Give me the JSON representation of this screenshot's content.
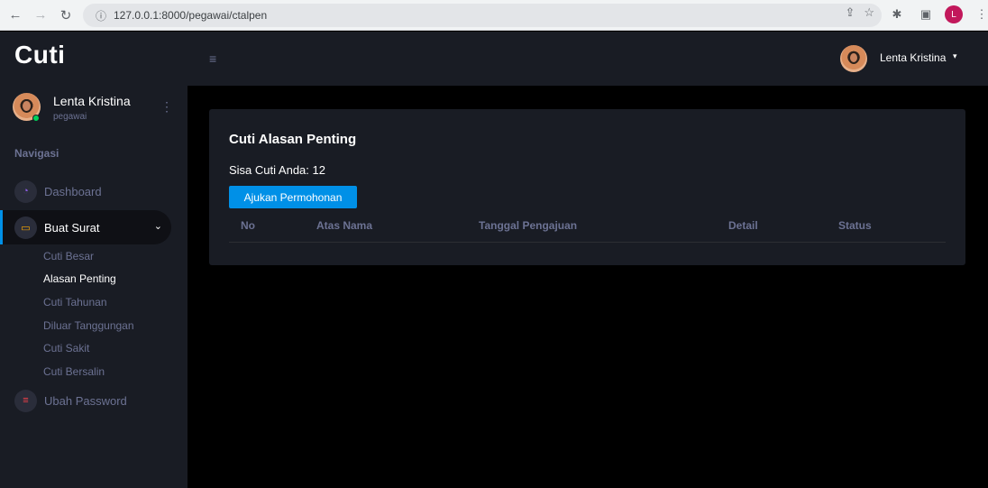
{
  "browser": {
    "url": "127.0.0.1:8000/pegawai/ctalpen",
    "profile_initial": "L"
  },
  "app": {
    "brand": "Cuti"
  },
  "sidebar": {
    "profile": {
      "name": "Lenta Kristina",
      "role": "pegawai",
      "status": "online"
    },
    "nav_title": "Navigasi",
    "items": [
      {
        "label": "Dashboard",
        "icon": "speedometer-icon",
        "icon_color": "#8f5fe8"
      },
      {
        "label": "Buat Surat",
        "icon": "laptop-icon",
        "icon_color": "#ffab00",
        "active": true
      },
      {
        "label": "Ubah Password",
        "icon": "key-icon",
        "icon_color": "#fc424a"
      }
    ],
    "sub_items": [
      {
        "label": "Cuti Besar"
      },
      {
        "label": "Alasan Penting",
        "current": true
      },
      {
        "label": "Cuti Tahunan"
      },
      {
        "label": "Diluar Tanggungan"
      },
      {
        "label": "Cuti Sakit"
      },
      {
        "label": "Cuti Bersalin"
      }
    ]
  },
  "topbar": {
    "user_name": "Lenta Kristina"
  },
  "main": {
    "card_title": "Cuti Alasan Penting",
    "sisa_cuti": "Sisa Cuti Anda: 12",
    "button_label": "Ajukan Permohonan",
    "table_headers": [
      "No",
      "Atas Nama",
      "Tanggal Pengajuan",
      "Detail",
      "Status"
    ],
    "rows": []
  },
  "colors": {
    "accent": "#0090e7",
    "sidebar_bg": "#191c24",
    "page_bg": "#000000",
    "muted": "#6c7293"
  }
}
